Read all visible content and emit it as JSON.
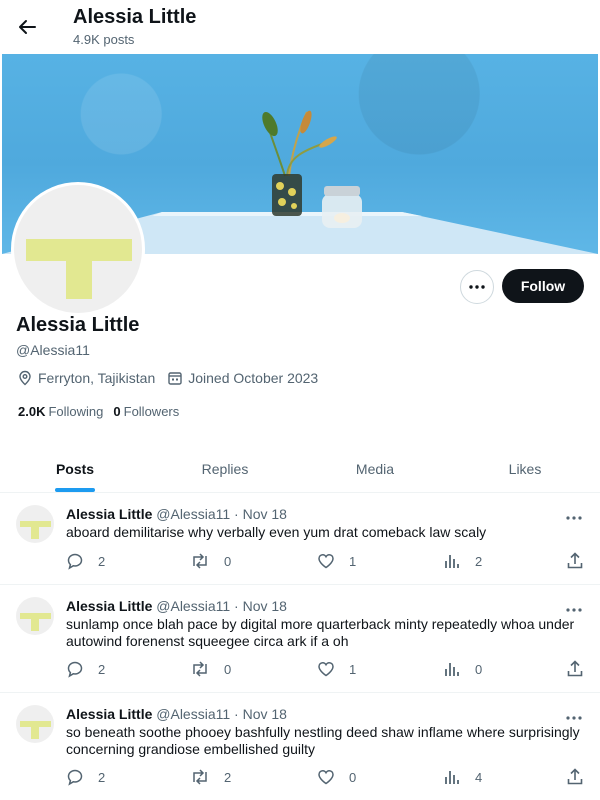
{
  "header": {
    "title": "Alessia Little",
    "post_count": "4.9K posts"
  },
  "profile": {
    "name": "Alessia Little",
    "handle": "@Alessia11",
    "location": "Ferryton, Tajikistan",
    "joined": "Joined October 2023",
    "following_count": "2.0K",
    "following_label": "Following",
    "followers_count": "0",
    "followers_label": "Followers",
    "follow_label": "Follow"
  },
  "tabs": [
    {
      "label": "Posts",
      "active": true
    },
    {
      "label": "Replies",
      "active": false
    },
    {
      "label": "Media",
      "active": false
    },
    {
      "label": "Likes",
      "active": false
    }
  ],
  "posts": [
    {
      "name": "Alessia Little",
      "handle": "@Alessia11",
      "sep": "·",
      "date": "Nov 18",
      "text": "aboard demilitarise why verbally even yum drat comeback law scaly",
      "replies": "2",
      "reposts": "0",
      "likes": "1",
      "views": "2"
    },
    {
      "name": "Alessia Little",
      "handle": "@Alessia11",
      "sep": "·",
      "date": "Nov 18",
      "text": "sunlamp once blah pace by digital more quarterback minty repeatedly whoa under autowind forenenst squeegee circa ark if a oh",
      "replies": "2",
      "reposts": "0",
      "likes": "1",
      "views": "0"
    },
    {
      "name": "Alessia Little",
      "handle": "@Alessia11",
      "sep": "·",
      "date": "Nov 18",
      "text": "so beneath soothe phooey bashfully nestling deed shaw inflame where surprisingly concerning grandiose embellished guilty",
      "replies": "2",
      "reposts": "2",
      "likes": "0",
      "views": "4"
    }
  ],
  "colors": {
    "accent": "#1d9bf0",
    "avatar_mark": "#e2e891",
    "text_secondary": "#536471"
  },
  "icons": [
    "back-arrow-icon",
    "location-icon",
    "calendar-icon",
    "more-icon",
    "reply-icon",
    "repost-icon",
    "like-icon",
    "views-icon",
    "share-icon"
  ]
}
